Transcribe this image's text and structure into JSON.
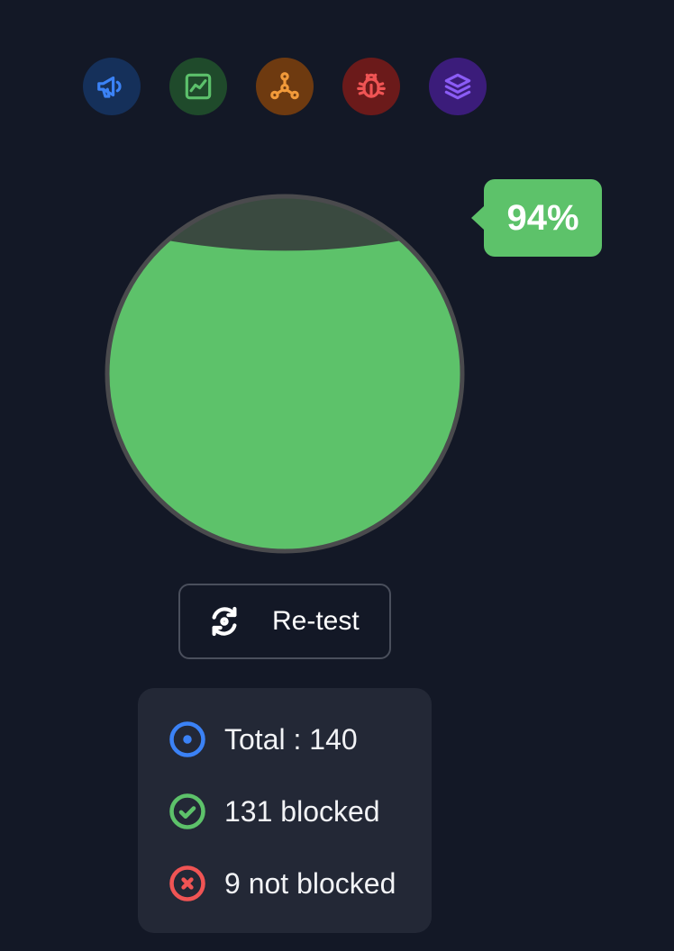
{
  "categories": [
    {
      "icon": "megaphone-icon",
      "color": "#3b82f6",
      "bg": "#15305a"
    },
    {
      "icon": "chart-icon",
      "color": "#5cc06b",
      "bg": "#1f4a2b"
    },
    {
      "icon": "network-icon",
      "color": "#f29a3a",
      "bg": "#6e3a10"
    },
    {
      "icon": "bug-icon",
      "color": "#f05454",
      "bg": "#6b1a1a"
    },
    {
      "icon": "layers-icon",
      "color": "#8b5cf6",
      "bg": "#3b1c7a"
    }
  ],
  "gauge": {
    "percent_label": "94%",
    "fill_fraction": 0.94,
    "fill_color": "#5dc26a",
    "empty_color": "#3a4a40",
    "ring_color": "#4a4a4d"
  },
  "retest": {
    "label": "Re-test",
    "icon": "refresh-icon"
  },
  "stats": {
    "total": "Total : 140",
    "blocked": "131 blocked",
    "not_blocked": "9 not blocked",
    "colors": {
      "total": "#3b82f6",
      "blocked": "#5dc26a",
      "not_blocked": "#f05454"
    }
  }
}
